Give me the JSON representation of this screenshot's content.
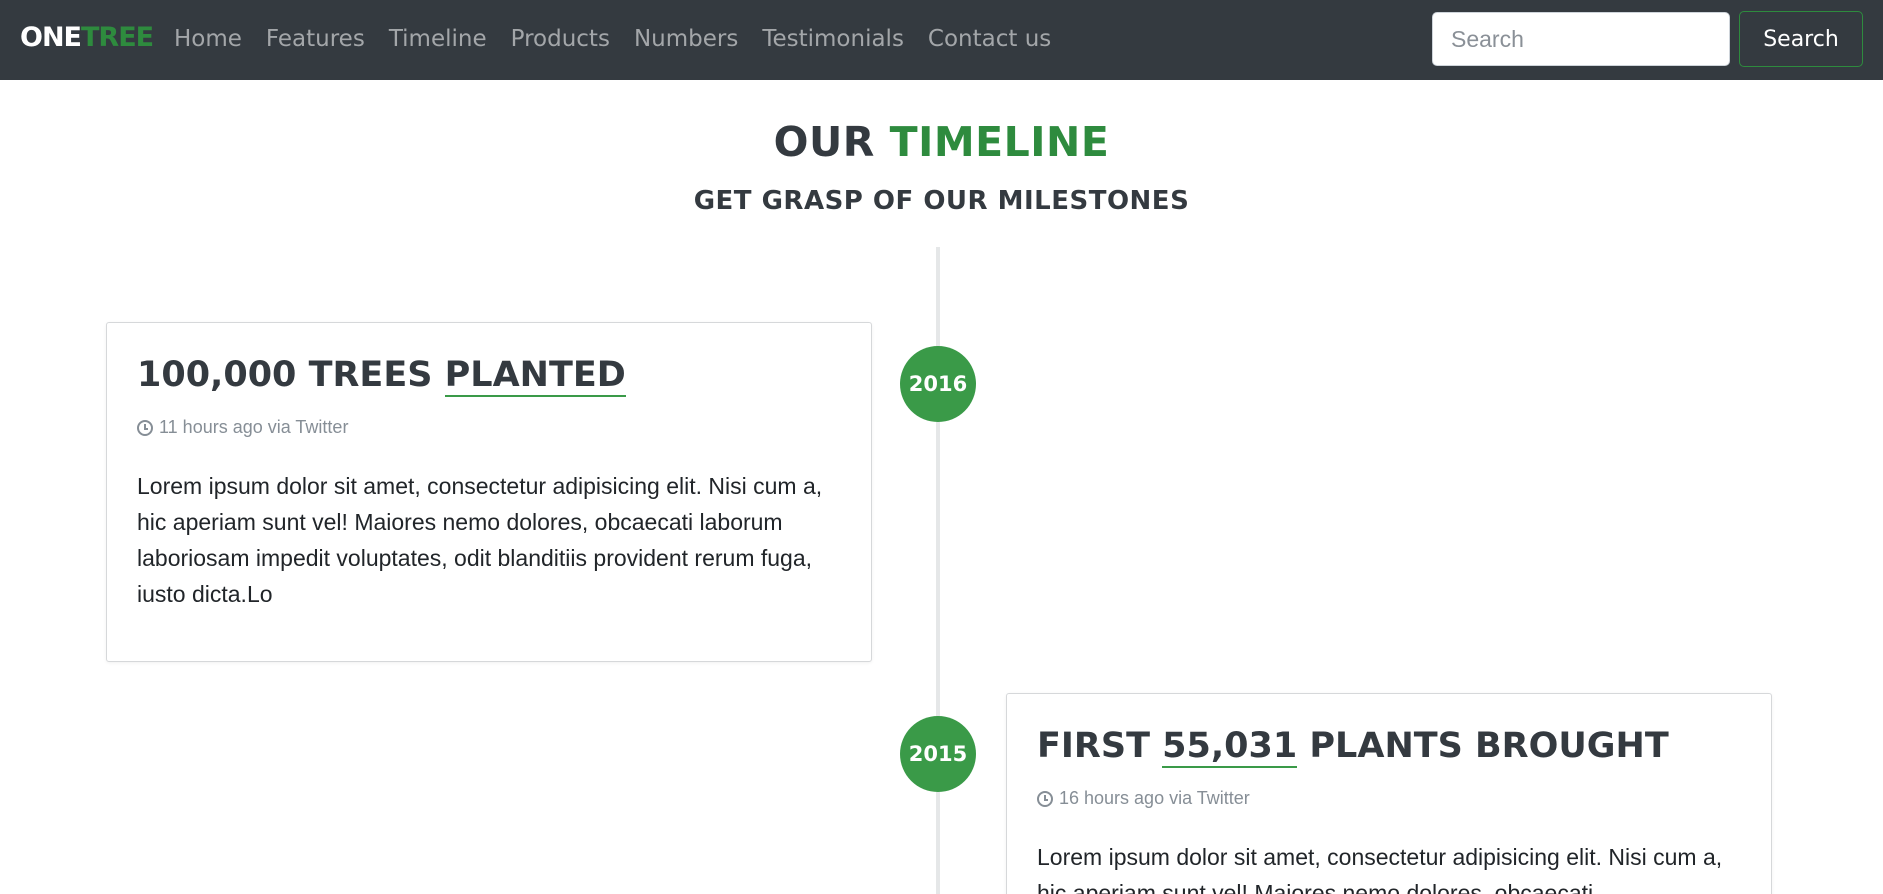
{
  "navbar": {
    "brand_one": "ONE",
    "brand_tree": "TREE",
    "links": [
      "Home",
      "Features",
      "Timeline",
      "Products",
      "Numbers",
      "Testimonials",
      "Contact us"
    ],
    "search_placeholder": "Search",
    "search_button": "Search"
  },
  "header": {
    "title_part1": "OUR ",
    "title_part2": "TIMELINE",
    "subtitle": "GET GRASP OF OUR MILESTONES"
  },
  "timeline": [
    {
      "year": "2016",
      "title_pre": "100,000 TREES ",
      "title_underlined": "PLANTED",
      "title_post": "",
      "meta": "11 hours ago via Twitter",
      "body": "Lorem ipsum dolor sit amet, consectetur adipisicing elit. Nisi cum a, hic aperiam sunt vel! Maiores nemo dolores, obcaecati laborum laboriosam impedit voluptates, odit blanditiis provident rerum fuga, iusto dicta.Lo"
    },
    {
      "year": "2015",
      "title_pre": "FIRST ",
      "title_underlined": "55,031",
      "title_post": " PLANTS BROUGHT",
      "meta": "16 hours ago via Twitter",
      "body": "Lorem ipsum dolor sit amet, consectetur adipisicing elit. Nisi cum a, hic aperiam sunt vel! Maiores nemo dolores, obcaecati"
    }
  ],
  "colors": {
    "navbar_bg": "#343a40",
    "accent_green": "#2e8b3e",
    "badge_green": "#3a9a48",
    "text_dark": "#343a40",
    "muted": "#868e96"
  },
  "icons": {
    "meta_icon": "clock-icon"
  }
}
